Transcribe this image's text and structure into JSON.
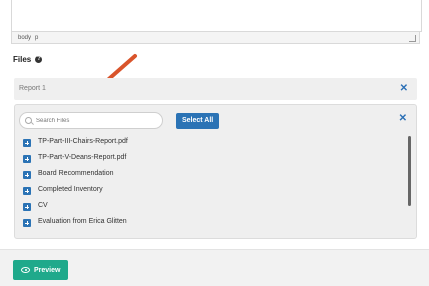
{
  "editor": {
    "status_body": "body",
    "status_p": "p"
  },
  "files": {
    "heading": "Files",
    "help_icon": "question-circle-icon"
  },
  "report": {
    "label": "Report 1",
    "remove_icon": "close-icon"
  },
  "picker": {
    "search_placeholder": "Search Files",
    "select_all_label": "Select All",
    "close_icon": "close-icon",
    "items": [
      {
        "name": "TP-Part-III-Chairs-Report.pdf"
      },
      {
        "name": "TP-Part-V-Deans-Report.pdf"
      },
      {
        "name": "Board Recommendation"
      },
      {
        "name": "Completed Inventory"
      },
      {
        "name": "CV"
      },
      {
        "name": "Evaluation from Erica Glitten"
      }
    ]
  },
  "footer": {
    "preview_label": "Preview",
    "preview_icon": "eye-icon"
  },
  "colors": {
    "accent_blue": "#2b73b5",
    "preview_green": "#1fa98b",
    "annotation_arrow": "#d9542b"
  }
}
